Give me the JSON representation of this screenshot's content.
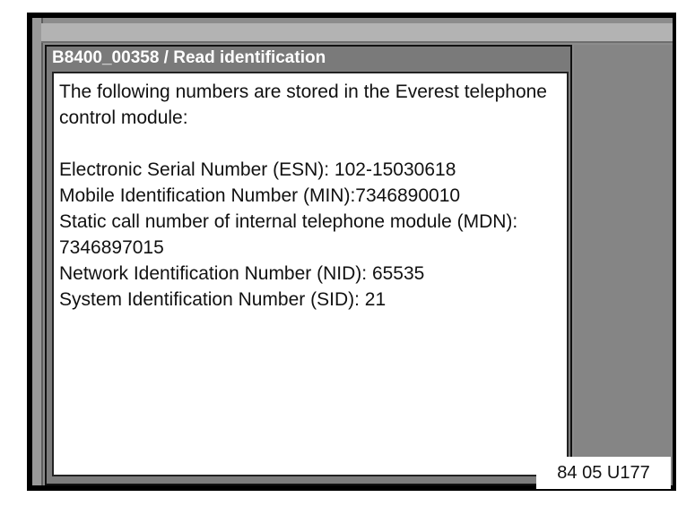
{
  "dialog": {
    "title": "B8400_00358 / Read identification",
    "intro": "The following numbers are stored in the Everest telephone control module:",
    "lines": [
      "Electronic Serial Number (ESN): 102-15030618",
      "Mobile Identification Number (MIN):7346890010",
      "Static call number of internal telephone module (MDN): 7346897015",
      "Network Identification Number (NID): 65535",
      "System Identification Number (SID): 21"
    ]
  },
  "reference_label": "84 05 U177"
}
